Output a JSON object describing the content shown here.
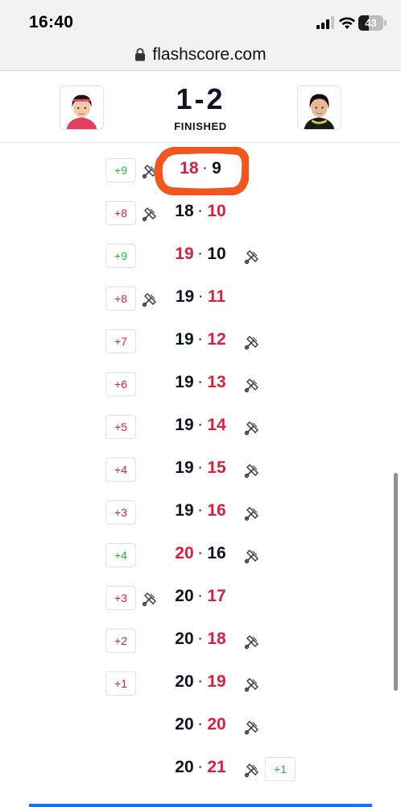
{
  "status_bar": {
    "time": "16:40",
    "battery": "43",
    "battery_level": 0.43,
    "icons": [
      "signal-icon",
      "wifi-icon",
      "battery-icon"
    ]
  },
  "browser": {
    "url": "flashscore.com",
    "lock_icon": "lock-icon"
  },
  "match": {
    "score": "1-2",
    "status": "FINISHED"
  },
  "colors": {
    "winner_red": "#dc1f3f",
    "lead_green": "#28b53a",
    "dark_text": "#0f1623",
    "highlight_orange": "#f2551d"
  },
  "points": [
    {
      "lead": "+9",
      "lead_side": "left",
      "lead_color": "green",
      "serve": "left",
      "home": "18",
      "away": "9",
      "winner": "home"
    },
    {
      "lead": "+8",
      "lead_side": "left",
      "lead_color": "red",
      "serve": "left",
      "home": "18",
      "away": "10",
      "winner": "away"
    },
    {
      "lead": "+9",
      "lead_side": "left",
      "lead_color": "green",
      "serve": "right",
      "home": "19",
      "away": "10",
      "winner": "home"
    },
    {
      "lead": "+8",
      "lead_side": "left",
      "lead_color": "red",
      "serve": "left",
      "home": "19",
      "away": "11",
      "winner": "away"
    },
    {
      "lead": "+7",
      "lead_side": "left",
      "lead_color": "red",
      "serve": "right",
      "home": "19",
      "away": "12",
      "winner": "away"
    },
    {
      "lead": "+6",
      "lead_side": "left",
      "lead_color": "red",
      "serve": "right",
      "home": "19",
      "away": "13",
      "winner": "away"
    },
    {
      "lead": "+5",
      "lead_side": "left",
      "lead_color": "red",
      "serve": "right",
      "home": "19",
      "away": "14",
      "winner": "away"
    },
    {
      "lead": "+4",
      "lead_side": "left",
      "lead_color": "red",
      "serve": "right",
      "home": "19",
      "away": "15",
      "winner": "away"
    },
    {
      "lead": "+3",
      "lead_side": "left",
      "lead_color": "red",
      "serve": "right",
      "home": "19",
      "away": "16",
      "winner": "away"
    },
    {
      "lead": "+4",
      "lead_side": "left",
      "lead_color": "green",
      "serve": "right",
      "home": "20",
      "away": "16",
      "winner": "home"
    },
    {
      "lead": "+3",
      "lead_side": "left",
      "lead_color": "red",
      "serve": "left",
      "home": "20",
      "away": "17",
      "winner": "away"
    },
    {
      "lead": "+2",
      "lead_side": "left",
      "lead_color": "red",
      "serve": "right",
      "home": "20",
      "away": "18",
      "winner": "away"
    },
    {
      "lead": "+1",
      "lead_side": "left",
      "lead_color": "red",
      "serve": "right",
      "home": "20",
      "away": "19",
      "winner": "away"
    },
    {
      "lead": "",
      "lead_side": "none",
      "lead_color": "red",
      "serve": "right",
      "home": "20",
      "away": "20",
      "winner": "away"
    },
    {
      "lead": "+1",
      "lead_side": "right",
      "lead_color": "green",
      "serve": "right",
      "home": "20",
      "away": "21",
      "winner": "away"
    }
  ]
}
